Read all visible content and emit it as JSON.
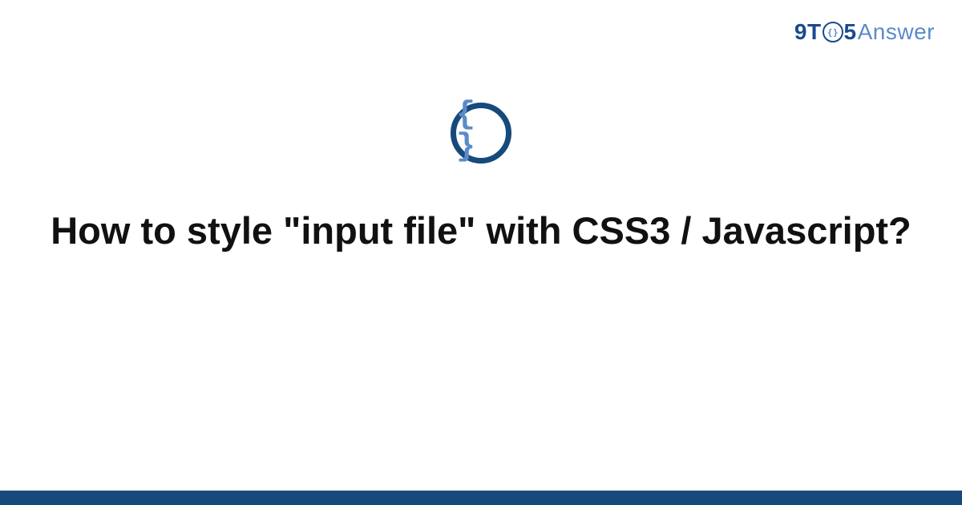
{
  "brand": {
    "prefix9": "9",
    "letterT": "T",
    "digit5": "5",
    "answer": "Answer",
    "badge_symbol": "{}"
  },
  "icon": {
    "name": "code-braces-icon",
    "glyph": "{ }"
  },
  "title": "How to style \"input file\" with CSS3 / Javascript?",
  "colors": {
    "brand_dark": "#164a7d",
    "brand_light": "#5b8bc9"
  }
}
